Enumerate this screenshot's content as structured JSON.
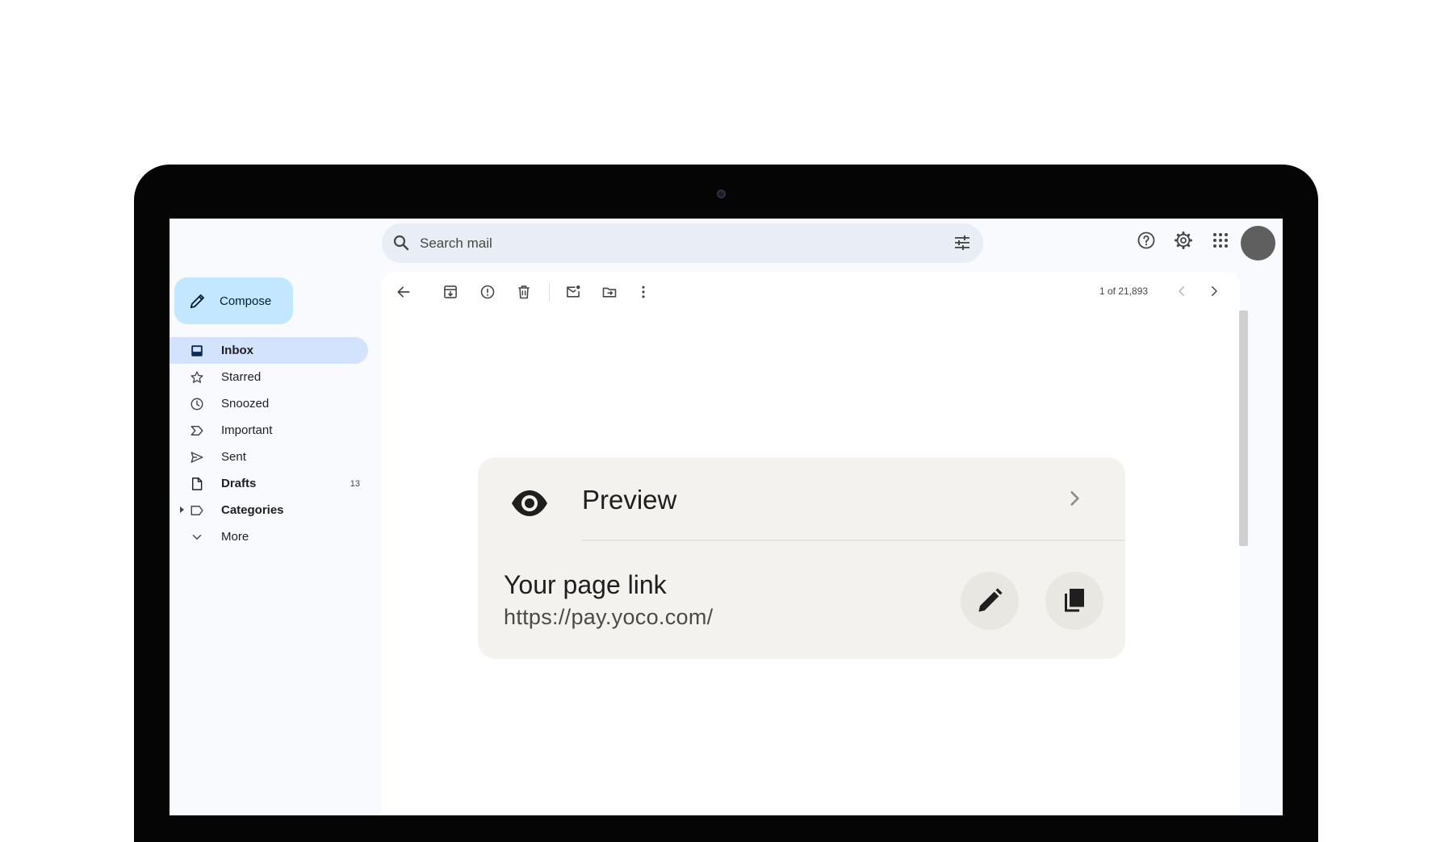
{
  "search": {
    "placeholder": "Search mail"
  },
  "header": {
    "icons": [
      "help-icon",
      "settings-icon",
      "apps-icon",
      "avatar"
    ]
  },
  "sidebar": {
    "compose_label": "Compose",
    "items": [
      {
        "label": "Inbox",
        "icon": "inbox-icon",
        "active": true,
        "bold": true,
        "count": ""
      },
      {
        "label": "Starred",
        "icon": "star-icon",
        "count": ""
      },
      {
        "label": "Snoozed",
        "icon": "clock-icon",
        "count": ""
      },
      {
        "label": "Important",
        "icon": "important-icon",
        "count": ""
      },
      {
        "label": "Sent",
        "icon": "send-icon",
        "count": ""
      },
      {
        "label": "Drafts",
        "icon": "draft-icon",
        "bold": true,
        "count": "13"
      },
      {
        "label": "Categories",
        "icon": "label-icon",
        "bold": true,
        "count": ""
      },
      {
        "label": "More",
        "icon": "chevron-down-icon",
        "count": ""
      }
    ]
  },
  "toolbar": {
    "pager": "1 of 21,893",
    "icons": [
      "back-arrow-icon",
      "archive-icon",
      "report-spam-icon",
      "delete-icon",
      "mark-unread-icon",
      "move-to-icon",
      "more-vert-icon",
      "chevron-left-icon",
      "chevron-right-icon"
    ]
  },
  "card": {
    "preview_label": "Preview",
    "link_title": "Your page link",
    "link_url": "https://pay.yoco.com/"
  },
  "colors": {
    "compose_bg": "#c2e7ff",
    "active_nav_bg": "#d3e3fd",
    "search_bg": "#e9eef6",
    "card_bg": "#f3f2ef"
  }
}
